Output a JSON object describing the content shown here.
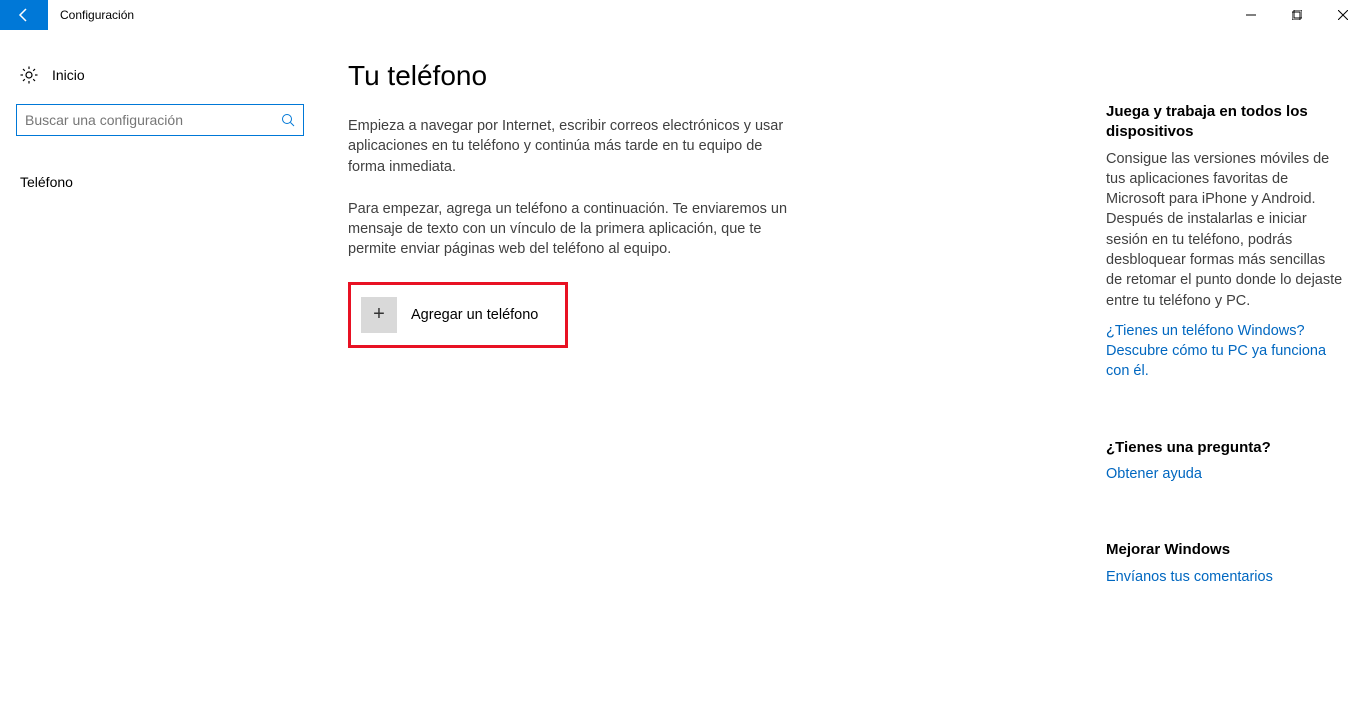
{
  "header": {
    "app_title": "Configuración"
  },
  "sidebar": {
    "home_label": "Inicio",
    "search_placeholder": "Buscar una configuración",
    "items": [
      {
        "label": "Teléfono"
      }
    ]
  },
  "main": {
    "title": "Tu teléfono",
    "para1": "Empieza a navegar por Internet, escribir correos electrónicos y usar aplicaciones en tu teléfono y continúa más tarde en tu equipo de forma inmediata.",
    "para2": "Para empezar, agrega un teléfono a continuación. Te enviaremos un mensaje de texto con un vínculo de la primera aplicación, que te permite enviar páginas web del teléfono al equipo.",
    "add_phone_label": "Agregar un teléfono"
  },
  "right": {
    "promo_heading": "Juega y trabaja en todos los dispositivos",
    "promo_text": "Consigue las versiones móviles de tus aplicaciones favoritas de Microsoft para iPhone y Android. Después de instalarlas e iniciar sesión en tu teléfono, podrás desbloquear formas más sencillas de retomar el punto donde lo dejaste entre tu teléfono y PC.",
    "promo_link": "¿Tienes un teléfono Windows? Descubre cómo tu PC ya funciona con él.",
    "question_heading": "¿Tienes una pregunta?",
    "question_link": "Obtener ayuda",
    "feedback_heading": "Mejorar Windows",
    "feedback_link": "Envíanos tus comentarios"
  }
}
